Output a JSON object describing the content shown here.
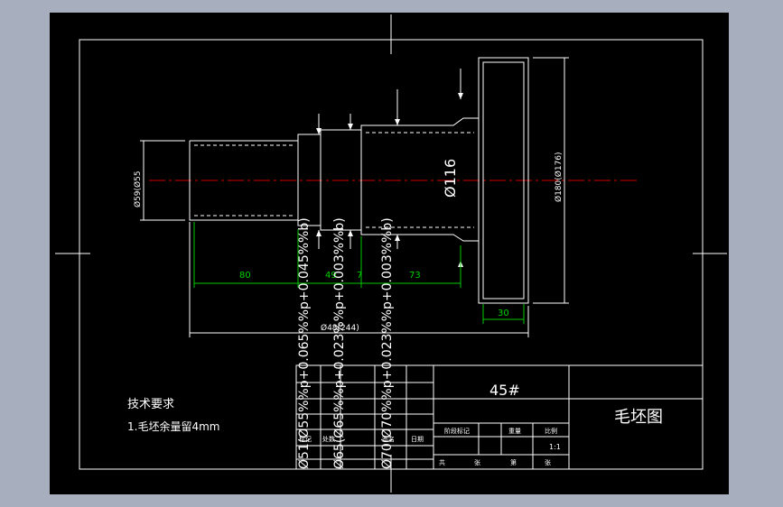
{
  "drawing": {
    "title": "毛坯图",
    "material": "45#",
    "scale": "1:1",
    "tech_requirements": {
      "heading": "技术要求",
      "item1": "1.毛坯余量留4mm"
    },
    "dimensions": {
      "dia_main": "Ø116",
      "dia_left": "Ø59(Ø55",
      "dia_right": "Ø180(Ø176)",
      "len_80": "80",
      "len_49": "49",
      "len_7": "7",
      "len_73": "73",
      "len_30": "30",
      "len_total": "Ø48(244)",
      "tol_1": "Ø51(Ø55%%p+0.065%%p+0.045%%b)",
      "tol_2": "Ø65(Ø65%%p+0.023%%p+0.003%%b)",
      "tol_3": "Ø70(Ø70%%p+0.023%%p+0.003%%b)"
    },
    "title_block": {
      "h_mark": "标记",
      "h_count": "处数",
      "h_sign": "签名",
      "h_date": "日期",
      "h_stage": "阶段标记",
      "h_weight": "重量",
      "h_scale": "比例",
      "h_total": "共",
      "h_sheet": "张",
      "h_no": "第"
    }
  },
  "colors": {
    "sheet": "#000000",
    "line": "#ffffff",
    "dimension": "#00c800",
    "centerline": "#d00000",
    "background": "#a7aebd"
  }
}
